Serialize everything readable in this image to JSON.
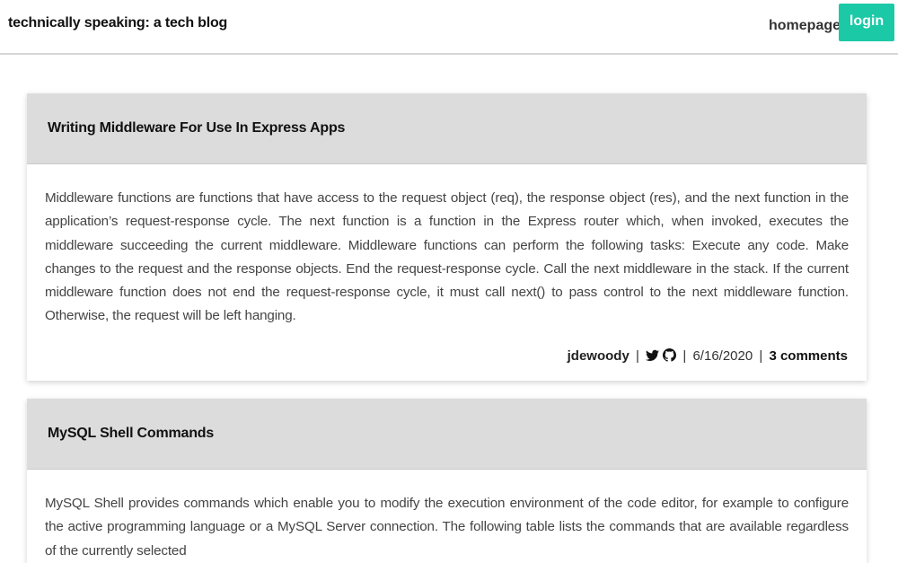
{
  "header": {
    "site_title": "technically speaking: a tech blog",
    "nav_home": "homepage",
    "nav_login": "login"
  },
  "colors": {
    "login_button": "#1bc9a6",
    "post_header_bg": "#dcdcdc"
  },
  "posts": [
    {
      "title": "Writing Middleware For Use In Express Apps",
      "body": "Middleware functions are functions that have access to the request object (req), the response object (res), and the next function in the application’s request-response cycle. The next function is a function in the Express router which, when invoked, executes the middleware succeeding the current middleware. Middleware functions can perform the following tasks: Execute any code. Make changes to the request and the response objects. End the request-response cycle. Call the next middleware in the stack. If the current middleware function does not end the request-response cycle, it must call next() to pass control to the next middleware function. Otherwise, the request will be left hanging.",
      "author": "jdewoody",
      "separator": "|",
      "icons": [
        "twitter-icon",
        "github-icon"
      ],
      "date": "6/16/2020",
      "comments": "3 comments"
    },
    {
      "title": "MySQL Shell Commands",
      "body": "MySQL Shell provides commands which enable you to modify the execution environment of the code editor, for example to configure the active programming language or a MySQL Server connection. The following table lists the commands that are available regardless of the currently selected"
    }
  ]
}
